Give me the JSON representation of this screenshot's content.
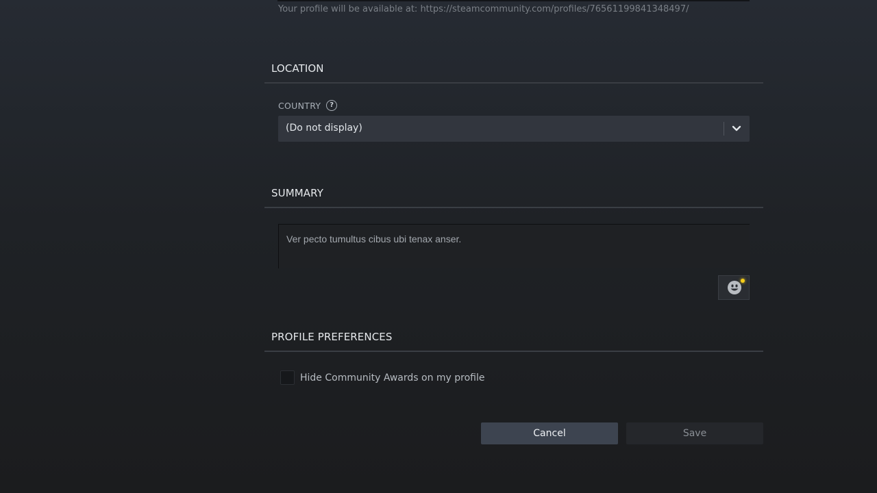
{
  "profile_url_note": "Your profile will be available at: https://steamcommunity.com/profiles/76561199841348497/",
  "sections": {
    "location": {
      "title": "LOCATION",
      "country_label": "COUNTRY",
      "help_glyph": "?",
      "country_value": "(Do not display)"
    },
    "summary": {
      "title": "SUMMARY",
      "text": "Ver pecto tumultus cibus ubi tenax anser."
    },
    "preferences": {
      "title": "PROFILE PREFERENCES",
      "hide_awards_label": "Hide Community Awards on my profile"
    }
  },
  "buttons": {
    "cancel": "Cancel",
    "save": "Save"
  },
  "colors": {
    "accent_notification": "#f5cd1a",
    "cancel_bg": "#3d4450",
    "save_bg": "#25272b"
  },
  "icons": {
    "help": "question-circle-icon",
    "dropdown": "chevron-down-icon",
    "emoticon": "smiley-face-icon"
  }
}
